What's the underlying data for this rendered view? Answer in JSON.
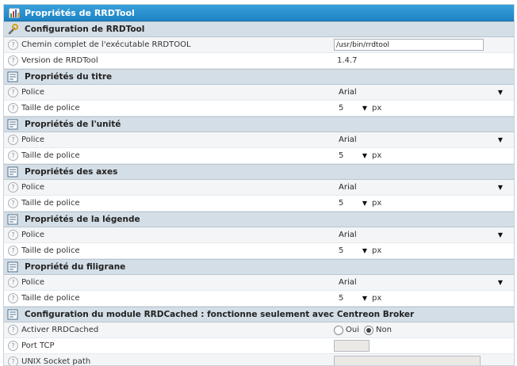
{
  "header": {
    "title": "Propriétés de RRDTool"
  },
  "config": {
    "title": "Configuration de RRDTool",
    "exec_label": "Chemin complet de l'exécutable RRDTOOL",
    "exec_value": "/usr/bin/rrdtool",
    "version_label": "Version de RRDTool",
    "version_value": "1.4.7"
  },
  "sections": [
    {
      "title": "Propriétés du titre",
      "font_label": "Police",
      "font_value": "Arial",
      "size_label": "Taille de police",
      "size_value": "5",
      "unit": "px"
    },
    {
      "title": "Propriétés de l'unité",
      "font_label": "Police",
      "font_value": "Arial",
      "size_label": "Taille de police",
      "size_value": "5",
      "unit": "px"
    },
    {
      "title": "Propriétés des axes",
      "font_label": "Police",
      "font_value": "Arial",
      "size_label": "Taille de police",
      "size_value": "5",
      "unit": "px"
    },
    {
      "title": "Propriétés de la légende",
      "font_label": "Police",
      "font_value": "Arial",
      "size_label": "Taille de police",
      "size_value": "5",
      "unit": "px"
    },
    {
      "title": "Propriété du filigrane",
      "font_label": "Police",
      "font_value": "Arial",
      "size_label": "Taille de police",
      "size_value": "5",
      "unit": "px"
    }
  ],
  "rrdcached": {
    "title": "Configuration du module RRDCached : fonctionne seulement avec Centreon Broker",
    "activate_label": "Activer RRDCached",
    "oui": "Oui",
    "non": "Non",
    "selected": "Non",
    "port_label": "Port TCP",
    "socket_label": "UNIX Socket path"
  },
  "icons": {
    "help": "?"
  }
}
